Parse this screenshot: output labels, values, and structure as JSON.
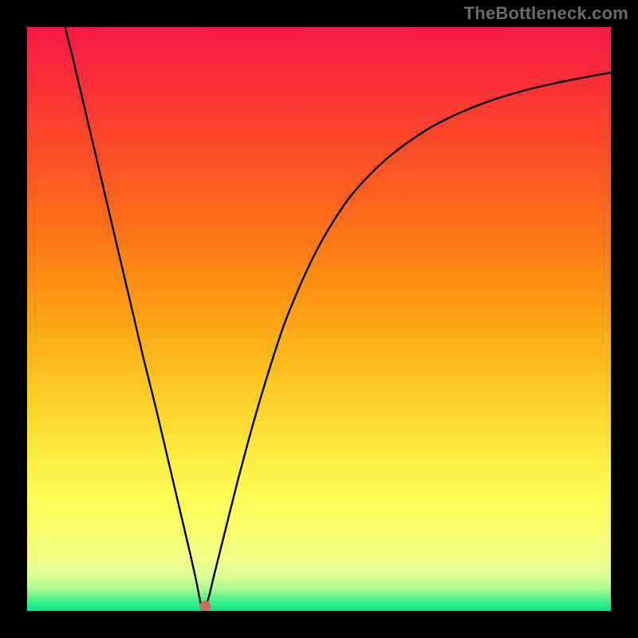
{
  "watermark": "TheBottleneck.com",
  "gradient_stops": [
    {
      "offset": 0.0,
      "color": "#fa1946"
    },
    {
      "offset": 0.1,
      "color": "#fb3137"
    },
    {
      "offset": 0.2,
      "color": "#fc4a29"
    },
    {
      "offset": 0.3,
      "color": "#fc651d"
    },
    {
      "offset": 0.4,
      "color": "#fc8314"
    },
    {
      "offset": 0.5,
      "color": "#fca313"
    },
    {
      "offset": 0.6,
      "color": "#fcc41e"
    },
    {
      "offset": 0.7,
      "color": "#fce335"
    },
    {
      "offset": 0.8,
      "color": "#fbfc54"
    },
    {
      "offset": 0.86,
      "color": "#f7fe69"
    },
    {
      "offset": 0.915,
      "color": "#f2fe8b"
    },
    {
      "offset": 0.945,
      "color": "#d6fd95"
    },
    {
      "offset": 0.965,
      "color": "#9bf994"
    },
    {
      "offset": 0.985,
      "color": "#39ef8c"
    },
    {
      "offset": 1.0,
      "color": "#00e984"
    }
  ],
  "chart_data": {
    "type": "line",
    "title": "",
    "xlabel": "",
    "ylabel": "",
    "xlim": [
      0,
      100
    ],
    "ylim": [
      0,
      100
    ],
    "legend": false,
    "grid": false,
    "note": "V-shaped bottleneck curve. y is mismatch (%) on a 0–100 scale; x is an unlabeled 0–100 parameter. Dip to ~0 at x≈30.",
    "series": [
      {
        "name": "bottleneck-curve",
        "color": "#000000",
        "x": [
          6.5,
          8,
          10,
          12,
          14,
          16,
          18,
          20,
          22,
          24,
          26,
          28,
          29,
          30,
          31,
          32,
          34,
          36,
          38,
          40,
          42,
          44,
          46,
          48,
          50,
          52,
          55,
          58,
          62,
          66,
          70,
          75,
          80,
          85,
          90,
          95,
          100
        ],
        "y": [
          100,
          94,
          85.5,
          77,
          68.5,
          60,
          51.5,
          43,
          35,
          26.5,
          18,
          9.5,
          5,
          0.5,
          2,
          6,
          14,
          22,
          29.5,
          36.5,
          43,
          49,
          54,
          58.5,
          62.5,
          66,
          70.5,
          74,
          77.8,
          80.8,
          83.3,
          85.7,
          87.6,
          89.1,
          90.3,
          91.3,
          92.2
        ]
      }
    ],
    "marker": {
      "x": 30.5,
      "y": 0.8,
      "color": "#cf6a5d",
      "radius_px": 7
    }
  }
}
